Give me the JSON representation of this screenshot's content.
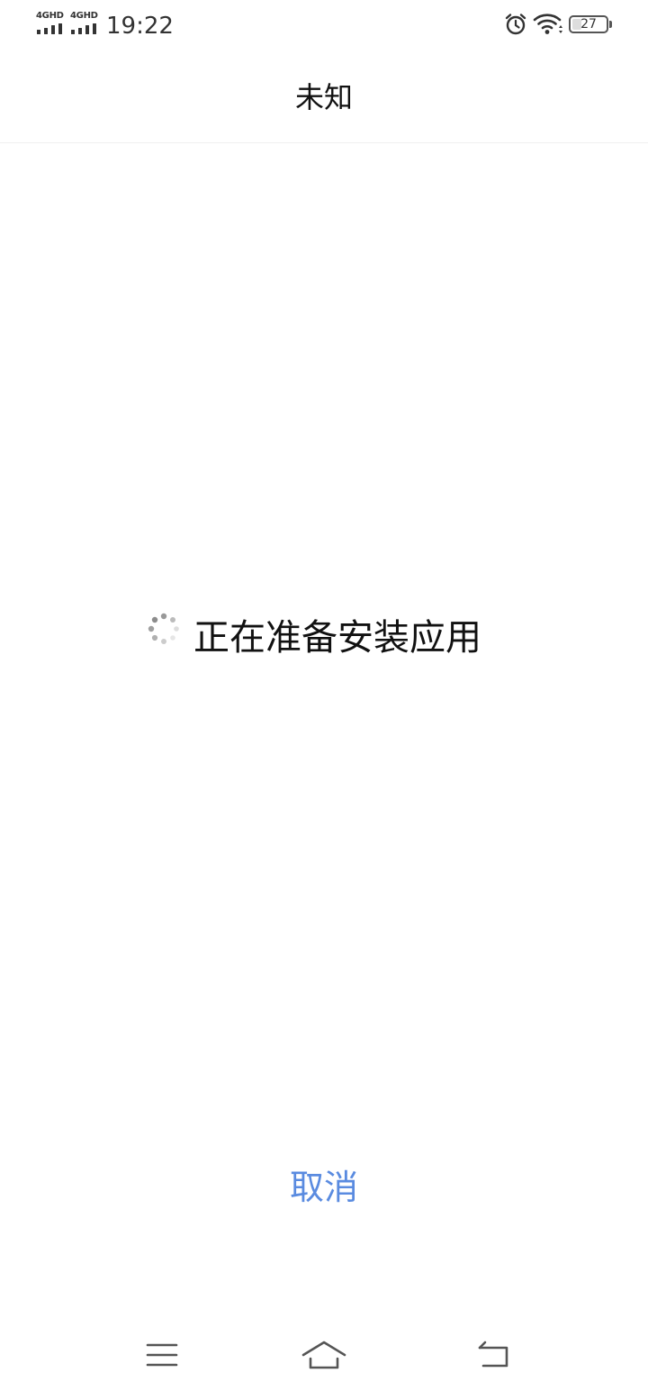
{
  "status_bar": {
    "sim1_label": "4GHD",
    "sim2_label": "4GHD",
    "time": "19:22",
    "battery_level": "27",
    "battery_fraction": 0.27
  },
  "header": {
    "title": "未知"
  },
  "progress": {
    "message": "正在准备安装应用"
  },
  "actions": {
    "cancel_label": "取消"
  },
  "icons": {
    "alarm": "alarm-clock-icon",
    "wifi": "wifi-icon",
    "spinner": "loading-spinner-icon",
    "menu": "menu-icon",
    "home": "home-icon",
    "back": "back-icon"
  },
  "colors": {
    "accent": "#5a8be0",
    "text": "#111111",
    "icon": "#555555"
  }
}
